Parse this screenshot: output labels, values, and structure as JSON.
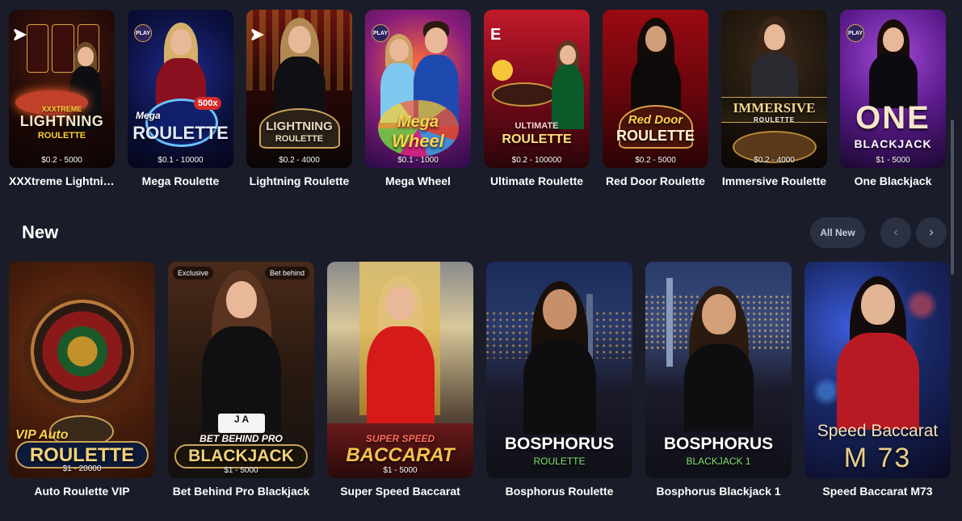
{
  "top_row": [
    {
      "title": "XXXtreme Lightni…",
      "stake": "$0.2 - 5000",
      "logo_line1": "XXXTREME",
      "logo_line2": "LIGHTNING",
      "logo_line3": "ROULETTE"
    },
    {
      "title": "Mega Roulette",
      "stake": "$0.1 - 10000",
      "logo_line1": "Mega",
      "logo_line2": "ROULETTE",
      "multiplier": "500x"
    },
    {
      "title": "Lightning Roulette",
      "stake": "$0.2 - 4000",
      "logo_line1": "LIGHTNING",
      "logo_line2": "ROULETTE"
    },
    {
      "title": "Mega Wheel",
      "stake": "$0.1 - 1000",
      "logo_line1": "Mega",
      "logo_line2": "Wheel"
    },
    {
      "title": "Ultimate Roulette",
      "stake": "$0.2 - 100000",
      "logo_line1": "ULTIMATE",
      "logo_line2": "ROULETTE"
    },
    {
      "title": "Red Door Roulette",
      "stake": "$0.2 - 5000",
      "logo_line1": "Red Door",
      "logo_line2": "ROULETTE"
    },
    {
      "title": "Immersive Roulette",
      "stake": "$0.2 - 4000",
      "logo_line1": "IMMERSIVE",
      "logo_line2": "ROULETTE"
    },
    {
      "title": "One Blackjack",
      "stake": "$1 - 5000",
      "logo_line1": "ONE",
      "logo_line2": "BLACKJACK"
    }
  ],
  "badges": {
    "play": "PLAY",
    "e": "E"
  },
  "section": {
    "title": "New",
    "all_label": "All New",
    "prev_icon": "‹",
    "next_icon": "›"
  },
  "new_row": [
    {
      "title": "Auto Roulette VIP",
      "stake": "$1 - 20000",
      "logo_line1": "VIP Auto",
      "logo_line2": "ROULETTE"
    },
    {
      "title": "Bet Behind Pro Blackjack",
      "stake": "$1 - 5000",
      "logo_line1": "BET BEHIND PRO",
      "logo_line2": "BLACKJACK",
      "tag_left": "Exclusive",
      "tag_right": "Bet behind",
      "cards": "J A"
    },
    {
      "title": "Super Speed Baccarat",
      "stake": "$1 - 5000",
      "logo_line1": "SUPER SPEED",
      "logo_line2": "BACCARAT"
    },
    {
      "title": "Bosphorus Roulette",
      "logo_line1": "BOSPHORUS",
      "logo_line2": "ROULETTE"
    },
    {
      "title": "Bosphorus Blackjack 1",
      "logo_line1": "BOSPHORUS",
      "logo_line2": "BLACKJACK 1"
    },
    {
      "title": "Speed Baccarat M73",
      "logo_line1": "Speed Baccarat",
      "logo_line2": "M 73"
    }
  ],
  "colors": {
    "background": "#1a1d29",
    "button_bg": "#2a3142",
    "gold": "#f2c14e",
    "green_sub": "#7fe36a"
  }
}
